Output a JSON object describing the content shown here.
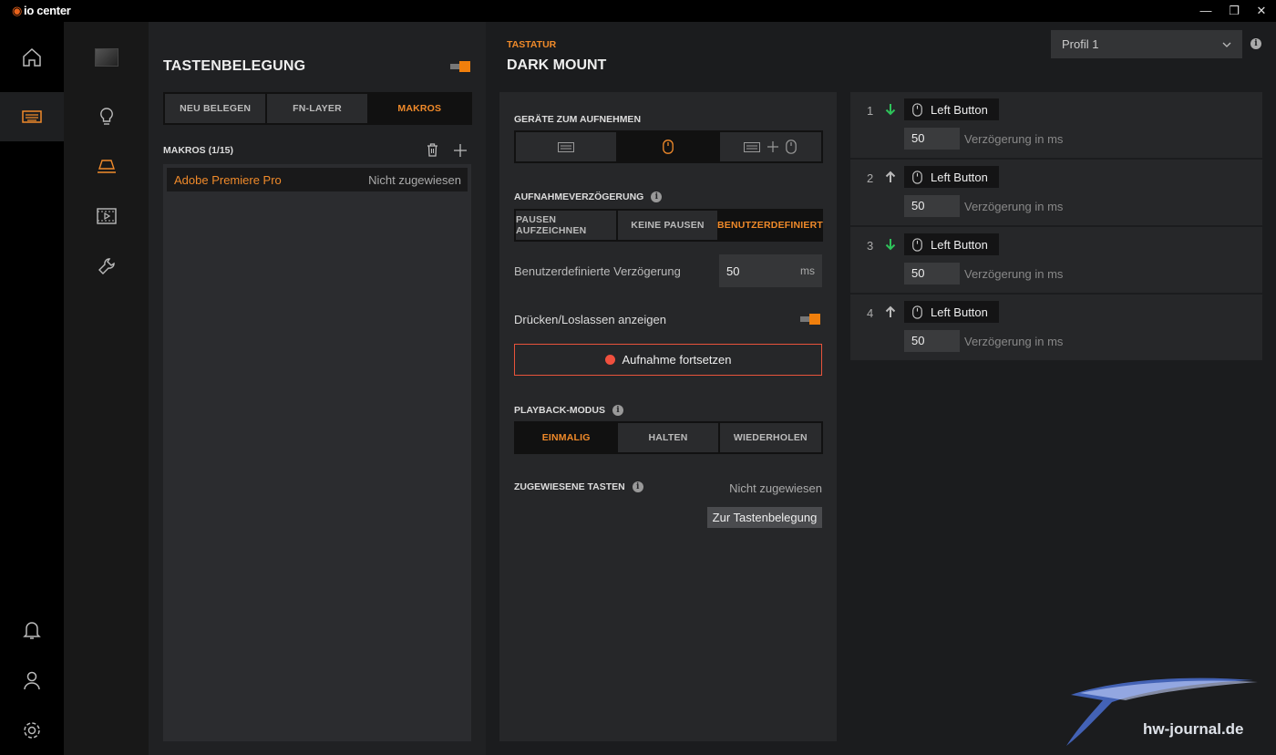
{
  "app": {
    "brand": "io center"
  },
  "window": {
    "minimize": "—",
    "restore": "❐",
    "close": "✕"
  },
  "rail": {
    "top": [
      "home-icon",
      "keyboard-icon"
    ],
    "bottom": [
      "bell-icon",
      "user-icon",
      "gear-icon"
    ]
  },
  "subnav": [
    "device-thumbnail",
    "bulb-icon",
    "keyboard-lamp-icon",
    "video-icon",
    "wrench-icon"
  ],
  "keymap": {
    "title": "TASTENBELEGUNG",
    "tabs": [
      {
        "label": "NEU BELEGEN",
        "active": false
      },
      {
        "label": "FN-LAYER",
        "active": false
      },
      {
        "label": "MAKROS",
        "active": true
      }
    ],
    "macros_header": "MAKROS (1/15)",
    "macros": [
      {
        "name": "Adobe Premiere Pro",
        "state": "Nicht zugewiesen"
      }
    ]
  },
  "device": {
    "category": "TASTATUR",
    "name": "DARK MOUNT"
  },
  "macro_settings": {
    "devices_label": "GERÄTE ZUM AUFNEHMEN",
    "delay_label": "AUFNAHMEVERZÖGERUNG",
    "delay_tabs": [
      {
        "label": "PAUSEN AUFZEICHNEN",
        "active": false
      },
      {
        "label": "KEINE PAUSEN",
        "active": false
      },
      {
        "label": "BENUTZERDEFINIERT",
        "active": true
      }
    ],
    "custom_delay_label": "Benutzerdefinierte Verzögerung",
    "custom_delay_value": "50",
    "custom_delay_unit": "ms",
    "press_release_label": "Drücken/Loslassen anzeigen",
    "record_button": "Aufnahme fortsetzen",
    "playback_label": "PLAYBACK-MODUS",
    "playback_tabs": [
      {
        "label": "EINMALIG",
        "active": true
      },
      {
        "label": "HALTEN",
        "active": false
      },
      {
        "label": "WIEDERHOLEN",
        "active": false
      }
    ],
    "assigned_label": "ZUGEWIESENE TASTEN",
    "assigned_value": "Nicht zugewiesen",
    "assign_button": "Zur Tastenbelegung"
  },
  "profile": {
    "selected": "Profil 1"
  },
  "steps": [
    {
      "num": "1",
      "dir": "down",
      "button": "Left Button",
      "delay": "50",
      "delay_label": "Verzögerung in ms"
    },
    {
      "num": "2",
      "dir": "up",
      "button": "Left Button",
      "delay": "50",
      "delay_label": "Verzögerung in ms"
    },
    {
      "num": "3",
      "dir": "down",
      "button": "Left Button",
      "delay": "50",
      "delay_label": "Verzögerung in ms"
    },
    {
      "num": "4",
      "dir": "up",
      "button": "Left Button",
      "delay": "50",
      "delay_label": "Verzögerung in ms"
    }
  ],
  "watermark": "hw-journal.de",
  "colors": {
    "accent": "#f08a2a",
    "record": "#f0503e",
    "down_arrow": "#2ec35a"
  }
}
